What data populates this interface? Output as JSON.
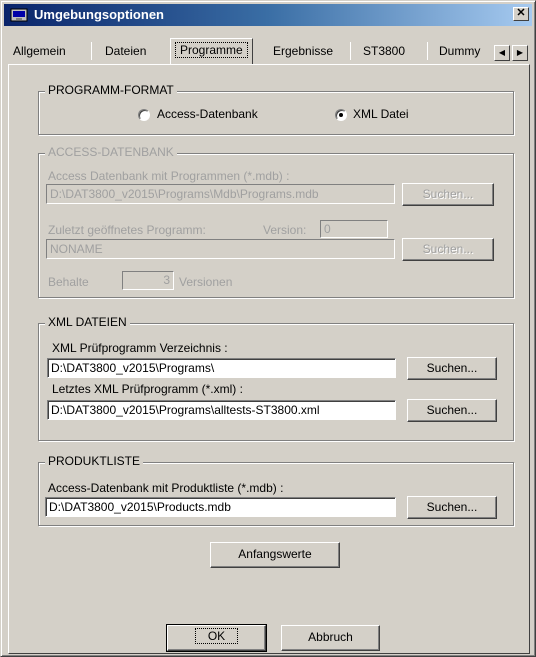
{
  "window": {
    "title": "Umgebungsoptionen",
    "close_glyph": "✕",
    "icon": "window-app-icon"
  },
  "tabs": [
    {
      "label": "Allgemein"
    },
    {
      "label": "Dateien"
    },
    {
      "label": "Programme",
      "selected": true
    },
    {
      "label": "Ergebnisse"
    },
    {
      "label": "ST3800"
    },
    {
      "label": "Dummy"
    }
  ],
  "tab_scroll": {
    "left": "◀",
    "right": "▶"
  },
  "program_format": {
    "title": "PROGRAMM-FORMAT",
    "options": [
      {
        "label": "Access-Datenbank",
        "selected": false
      },
      {
        "label": "XML Datei",
        "selected": true
      }
    ]
  },
  "access_db": {
    "title": "ACCESS-DATENBANK",
    "db_label": "Access Datenbank mit Programmen (*.mdb) :",
    "db_path": "D:\\DAT3800_v2015\\Programs\\Mdb\\Programs.mdb",
    "search1": "Suchen...",
    "last_label": "Zuletzt geöffnetes Programm:",
    "version_label": "Version:",
    "version_value": "0",
    "last_value": "NONAME",
    "search2": "Suchen...",
    "keep_label": "Behalte",
    "keep_value": "3",
    "versions_label": "Versionen"
  },
  "xml_files": {
    "title": "XML DATEIEN",
    "dir_label": "XML Prüfprogramm Verzeichnis :",
    "dir_path": "D:\\DAT3800_v2015\\Programs\\",
    "search1": "Suchen...",
    "last_label": "Letztes XML Prüfprogramm (*.xml) :",
    "last_path": "D:\\DAT3800_v2015\\Programs\\alltests-ST3800.xml",
    "search2": "Suchen..."
  },
  "product_list": {
    "title": "PRODUKTLISTE",
    "db_label": "Access-Datenbank mit Produktliste (*.mdb) :",
    "db_path": "D:\\DAT3800_v2015\\Products.mdb",
    "search": "Suchen..."
  },
  "defaults_button": "Anfangswerte",
  "ok_button": "OK",
  "cancel_button": "Abbruch"
}
